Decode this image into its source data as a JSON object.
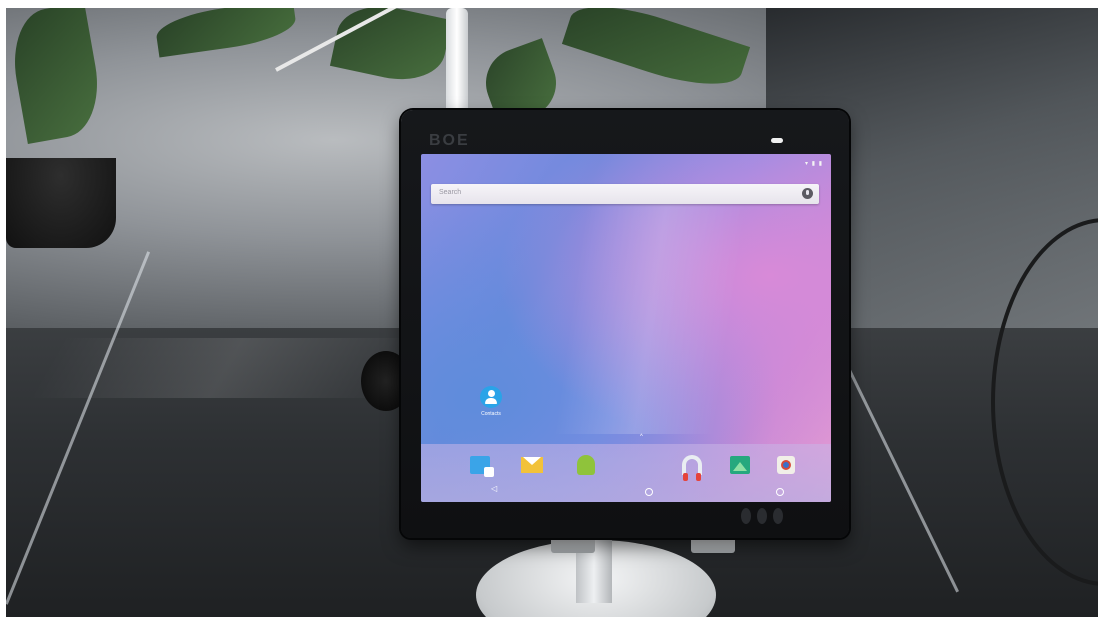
{
  "device": {
    "brand": "BOE"
  },
  "screen": {
    "search_placeholder": "Search",
    "home_apps": [
      {
        "label": "Contacts",
        "icon": "contacts-icon",
        "color": "#2aa3e8"
      }
    ],
    "dock_icons": [
      {
        "icon": "messaging-icon",
        "color": "#3aa4e8"
      },
      {
        "icon": "email-icon",
        "color": "#f2c23a"
      },
      {
        "icon": "android-icon",
        "color": "#8fc33b"
      },
      {
        "icon": "music-headphones-icon",
        "color": "#e5433b"
      },
      {
        "icon": "gallery-icon",
        "color": "#26a87e"
      },
      {
        "icon": "browser-icon",
        "color": "#3b6fc9"
      }
    ],
    "nav_buttons": [
      "back-icon",
      "home-icon",
      "recents-icon"
    ]
  }
}
